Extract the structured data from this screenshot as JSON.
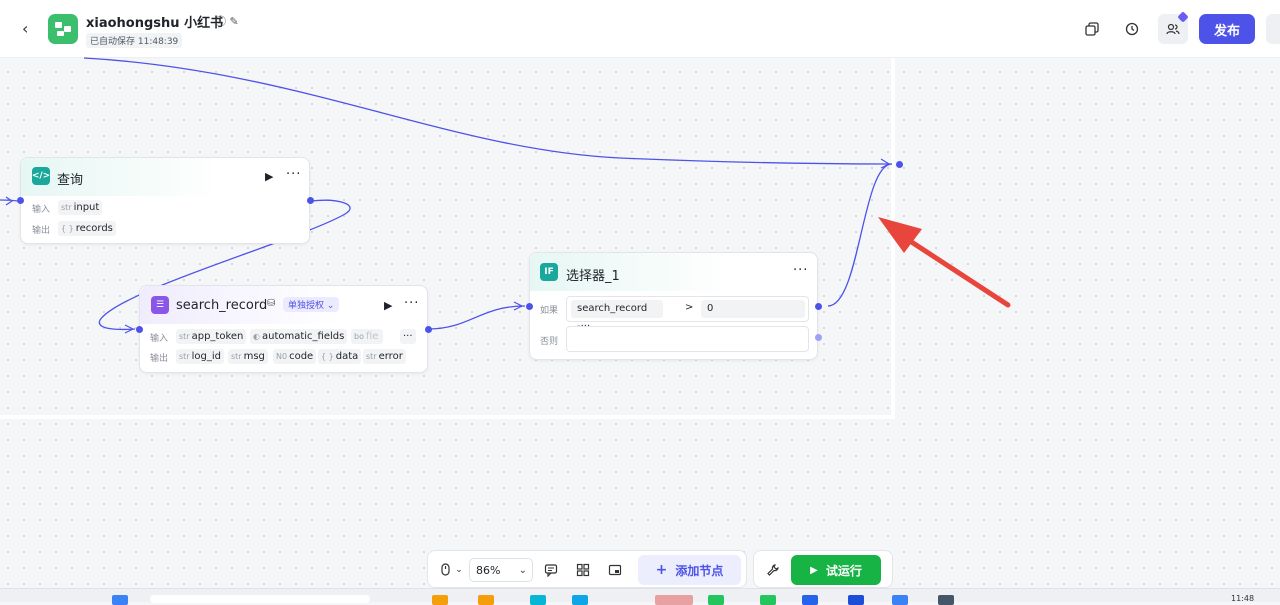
{
  "header": {
    "app_name": "xiaohongshu  小红书",
    "autosave": "已自动保存 11:48:39",
    "publish_label": "发布"
  },
  "nodes": {
    "query": {
      "title": "查询",
      "input_label": "输入",
      "output_label": "输出",
      "input_tag": {
        "type": "str",
        "name": "input"
      },
      "output_tag": {
        "type": "{ }",
        "name": "records"
      }
    },
    "search_record": {
      "title": "search_record",
      "auth_badge": "单独授权",
      "input_label": "输入",
      "output_label": "输出",
      "inputs": [
        {
          "type": "str",
          "name": "app_token"
        },
        {
          "type": "",
          "name": "automatic_fields"
        },
        {
          "type": "bo",
          "name": "fie"
        }
      ],
      "outputs": [
        {
          "type": "str",
          "name": "log_id"
        },
        {
          "type": "N0",
          "name": "code"
        },
        {
          "type": "{ }",
          "name": "data"
        },
        {
          "type": "str",
          "name": "msg"
        },
        {
          "type": "str",
          "name": "error"
        }
      ],
      "more_inputs": "···"
    },
    "selector": {
      "title": "选择器_1",
      "icon_text": "IF",
      "if_label": "如果",
      "else_label": "否则",
      "condition_left": "search_record -···",
      "condition_op": ">",
      "condition_right": "0"
    }
  },
  "toolbar": {
    "zoom": "86%",
    "add_node_label": "添加节点",
    "run_label": "试运行"
  },
  "taskbar": {
    "clock": "11:48"
  },
  "colors": {
    "accent": "#4d53e8",
    "run_green": "#17b345",
    "annotation_arrow": "#e8453c"
  }
}
